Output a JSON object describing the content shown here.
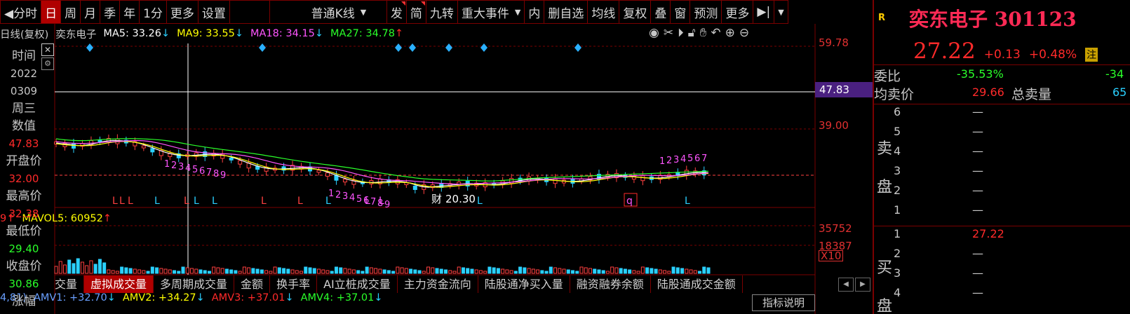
{
  "toolbar": {
    "items": [
      {
        "label": "◀分时",
        "active": false
      },
      {
        "label": "日",
        "active": true
      },
      {
        "label": "周",
        "active": false
      },
      {
        "label": "月",
        "active": false
      },
      {
        "label": "季",
        "active": false
      },
      {
        "label": "年",
        "active": false
      },
      {
        "label": "1分",
        "active": false
      },
      {
        "label": "更多",
        "active": false
      },
      {
        "label": "设置",
        "active": false
      }
    ],
    "kline_select": "普通K线",
    "items2": [
      "发",
      "简",
      "九转",
      "重大事件"
    ],
    "items3": [
      "内",
      "删自选",
      "均线",
      "复权",
      "叠",
      "窗",
      "预测",
      "更多"
    ]
  },
  "ma": {
    "prefix": "日线(复权)",
    "stock": "奕东电子",
    "ma5": "MA5: 33.26",
    "ma9": "MA9: 33.55",
    "ma18": "MA18: 34.15",
    "ma27": "MA27: 34.78",
    "colors": {
      "ma5": "#ffffff",
      "ma9": "#ffff00",
      "ma18": "#ff55ff",
      "ma27": "#2aff2a"
    }
  },
  "left_info": {
    "rows": [
      "时间",
      "2022",
      "0309",
      "周三",
      "数值",
      "47.83",
      "开盘价",
      "32.00",
      "最高价",
      "32.38",
      "最低价",
      "29.40",
      "收盘价",
      "30.86",
      "涨幅"
    ]
  },
  "axis": {
    "p1": "59.78",
    "p2": "47.83",
    "p3": "39.00",
    "v1": "35752",
    "v2": "18387",
    "unit": "X10"
  },
  "chart_labels": {
    "annot_low": "20.30",
    "cai": "财",
    "q": "q",
    "l": "L"
  },
  "vol": {
    "prefix": "9↑",
    "mavol5": "MAVOL5: 60952"
  },
  "indicator_tabs": [
    "交量",
    "虚拟成交量",
    "多周期成交量",
    "金额",
    "换手率",
    "AI立桩成交量",
    "主力资金流向",
    "陆股通净买入量",
    "融资融券余额",
    "陆股通成交金额"
  ],
  "indicator_explain": "指标说明",
  "amv": {
    "prefix": "4,81)",
    "amv1": "AMV1: +32.70",
    "amv2": "AMV2: +34.27",
    "amv3": "AMV3: +37.01",
    "amv4": "AMV4: +37.01"
  },
  "right": {
    "badge": "R",
    "title": "奕东电子 301123",
    "price": "27.22",
    "change": "+0.13",
    "change_pct": "+0.48%",
    "note": "注",
    "weibi_label": "委比",
    "weibi_pct": "-35.53%",
    "weibi_val": "-34",
    "avg_sell_label": "均卖价",
    "avg_sell": "29.66",
    "total_sell_label": "总卖量",
    "total_sell": "65",
    "sell_side": "卖盘",
    "buy_side": "买盘",
    "sell_rows": [
      {
        "n": "6",
        "p": "—"
      },
      {
        "n": "5",
        "p": "—"
      },
      {
        "n": "4",
        "p": "—"
      },
      {
        "n": "3",
        "p": "—"
      },
      {
        "n": "2",
        "p": "—"
      },
      {
        "n": "1",
        "p": "—"
      }
    ],
    "buy_rows": [
      {
        "n": "1",
        "p": "27.22"
      },
      {
        "n": "2",
        "p": "—"
      },
      {
        "n": "3",
        "p": "—"
      },
      {
        "n": "4",
        "p": "—"
      }
    ]
  }
}
